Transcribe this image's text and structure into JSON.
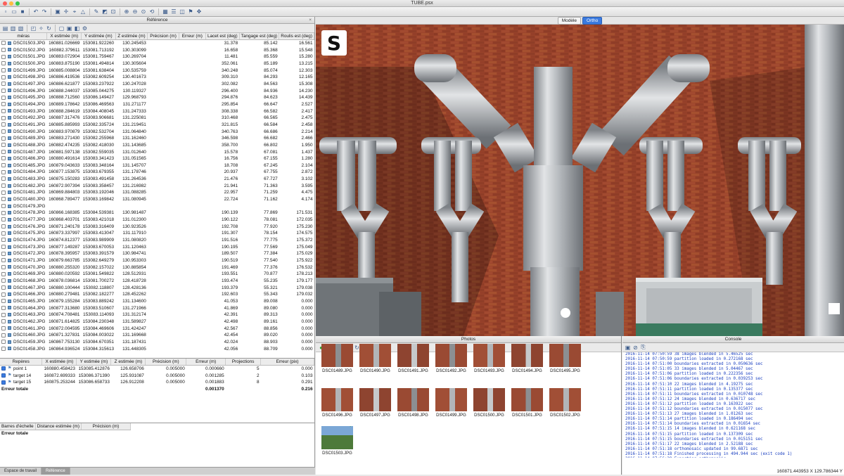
{
  "window": {
    "title": "TUBE.psx"
  },
  "reference_panel": {
    "title": "Référence",
    "columns": [
      "méras",
      "X estimée (m)",
      "Y estimée (m)",
      "Z estimée (m)",
      "Précision (m)",
      "Erreur (m)",
      "Lacet est (deg)",
      "Tangage est (deg)",
      "Roulis est (deg)"
    ],
    "cameras": [
      [
        "DSC01503.JPG",
        "160881.026669",
        "153081.922260",
        "130.245453",
        "",
        "",
        "31.378",
        "85.142",
        "16.561"
      ],
      [
        "DSC01502.JPG",
        "160882.379611",
        "153081.713192",
        "130.303099",
        "",
        "",
        "16.658",
        "85.368",
        "15.548"
      ],
      [
        "DSC01501.JPG",
        "160883.072904",
        "153081.759467",
        "130.269704",
        "",
        "",
        "11.481",
        "85.559",
        "15.280"
      ],
      [
        "DSC01500.JPG",
        "160883.875190",
        "153081.494814",
        "130.305604",
        "",
        "",
        "352.061",
        "85.189",
        "13.215"
      ],
      [
        "DSC01499.JPG",
        "160885.008804",
        "153081.638404",
        "130.535759",
        "",
        "",
        "340.248",
        "85.074",
        "12.303"
      ],
      [
        "DSC01498.JPG",
        "160886.419536",
        "153082.609254",
        "130.401673",
        "",
        "",
        "309.310",
        "84.293",
        "12.165"
      ],
      [
        "DSC01497.JPG",
        "160886.621877",
        "153083.237922",
        "130.247028",
        "",
        "",
        "302.082",
        "84.563",
        "15.308"
      ],
      [
        "DSC01496.JPG",
        "160888.244037",
        "153085.044275",
        "130.119327",
        "",
        "",
        "296.400",
        "84.936",
        "14.230"
      ],
      [
        "DSC01495.JPG",
        "160888.712560",
        "153086.149427",
        "129.968793",
        "",
        "",
        "294.876",
        "84.623",
        "14.439"
      ],
      [
        "DSC01494.JPG",
        "160889.178642",
        "153086.469563",
        "131.271177",
        "",
        "",
        "295.854",
        "66.647",
        "2.527"
      ],
      [
        "DSC01493.JPG",
        "160888.284619",
        "153084.408045",
        "131.247333",
        "",
        "",
        "308.338",
        "66.582",
        "2.417"
      ],
      [
        "DSC01492.JPG",
        "160887.317476",
        "153083.906681",
        "131.225081",
        "",
        "",
        "310.468",
        "66.565",
        "2.475"
      ],
      [
        "DSC01491.JPG",
        "160885.885993",
        "153082.335724",
        "131.219451",
        "",
        "",
        "321.815",
        "66.584",
        "2.458"
      ],
      [
        "DSC01490.JPG",
        "160883.970879",
        "153082.532704",
        "131.064840",
        "",
        "",
        "340.763",
        "66.686",
        "2.214"
      ],
      [
        "DSC01489.JPG",
        "160883.271430",
        "153082.255968",
        "131.162460",
        "",
        "",
        "346.598",
        "66.682",
        "2.466"
      ],
      [
        "DSC01488.JPG",
        "160882.474235",
        "153082.418030",
        "131.143685",
        "",
        "",
        "358.700",
        "66.802",
        "1.950"
      ],
      [
        "DSC01487.JPG",
        "160881.597138",
        "153082.559035",
        "131.012640",
        "",
        "",
        "15.578",
        "67.081",
        "1.437"
      ],
      [
        "DSC01486.JPG",
        "160880.491614",
        "153083.341423",
        "131.051565",
        "",
        "",
        "16.756",
        "67.155",
        "1.280"
      ],
      [
        "DSC01485.JPG",
        "160879.043633",
        "153083.348164",
        "131.145707",
        "",
        "",
        "18.708",
        "67.245",
        "2.104"
      ],
      [
        "DSC01484.JPG",
        "160877.153875",
        "153083.679355",
        "131.178746",
        "",
        "",
        "20.937",
        "67.755",
        "2.872"
      ],
      [
        "DSC01483.JPG",
        "160875.150283",
        "153083.491458",
        "131.264536",
        "",
        "",
        "21.476",
        "67.727",
        "3.102"
      ],
      [
        "DSC01482.JPG",
        "160872.907394",
        "153083.358457",
        "131.216982",
        "",
        "",
        "21.941",
        "71.363",
        "3.595"
      ],
      [
        "DSC01481.JPG",
        "160869.884803",
        "153083.192046",
        "131.088285",
        "",
        "",
        "22.957",
        "71.259",
        "4.475"
      ],
      [
        "DSC01480.JPG",
        "160868.789477",
        "153083.169842",
        "131.080945",
        "",
        "",
        "22.724",
        "71.162",
        "4.174"
      ],
      [
        "DSC01479.JPG",
        "",
        "",
        "",
        "",
        "",
        "",
        "",
        ""
      ],
      [
        "DSC01478.JPG",
        "160866.168385",
        "153084.539381",
        "130.981487",
        "",
        "",
        "190.139",
        "77.869",
        "171.531"
      ],
      [
        "DSC01477.JPG",
        "160868.403701",
        "153083.421018",
        "131.012300",
        "",
        "",
        "190.122",
        "78.081",
        "172.035"
      ],
      [
        "DSC01476.JPG",
        "160871.240178",
        "153083.316409",
        "130.923526",
        "",
        "",
        "192.708",
        "77.920",
        "175.230"
      ],
      [
        "DSC01475.JPG",
        "160873.337997",
        "153083.413047",
        "131.117910",
        "",
        "",
        "191.307",
        "78.154",
        "174.575"
      ],
      [
        "DSC01474.JPG",
        "160874.812377",
        "153083.989909",
        "131.080820",
        "",
        "",
        "191.516",
        "77.775",
        "175.372"
      ],
      [
        "DSC01473.JPG",
        "160877.149287",
        "153083.670053",
        "131.120463",
        "",
        "",
        "190.195",
        "77.569",
        "175.049"
      ],
      [
        "DSC01472.JPG",
        "160878.395957",
        "153083.391579",
        "130.984741",
        "",
        "",
        "189.507",
        "77.384",
        "175.029"
      ],
      [
        "DSC01471.JPG",
        "160879.663785",
        "153082.649279",
        "130.953303",
        "",
        "",
        "190.519",
        "77.540",
        "175.922"
      ],
      [
        "DSC01470.JPG",
        "160880.255320",
        "153082.157022",
        "130.885854",
        "",
        "",
        "191.469",
        "77.376",
        "176.532"
      ],
      [
        "DSC01469.JPG",
        "160880.020592",
        "153081.549822",
        "128.512931",
        "",
        "",
        "193.551",
        "70.877",
        "178.213"
      ],
      [
        "DSC01468.JPG",
        "160878.036814",
        "153081.700272",
        "128.418728",
        "",
        "",
        "193.474",
        "55.235",
        "179.177"
      ],
      [
        "DSC01467.JPG",
        "160880.100444",
        "153082.118807",
        "128.428136",
        "",
        "",
        "193.379",
        "55.321",
        "179.038"
      ],
      [
        "DSC01466.JPG",
        "160880.279481",
        "153082.182277",
        "128.452262",
        "",
        "",
        "192.603",
        "55.343",
        "179.032"
      ],
      [
        "DSC01465.JPG",
        "160879.155284",
        "153083.889242",
        "131.134600",
        "",
        "",
        "41.053",
        "89.008",
        "0.000"
      ],
      [
        "DSC01464.JPG",
        "160877.313680",
        "153083.510607",
        "131.271966",
        "",
        "",
        "41.869",
        "89.080",
        "0.000"
      ],
      [
        "DSC01463.JPG",
        "160874.708481",
        "153083.114093",
        "131.312174",
        "",
        "",
        "42.391",
        "89.313",
        "0.000"
      ],
      [
        "DSC01462.JPG",
        "160871.614825",
        "153084.230348",
        "131.589827",
        "",
        "",
        "42.498",
        "89.161",
        "0.000"
      ],
      [
        "DSC01461.JPG",
        "160872.004595",
        "153084.469606",
        "131.424247",
        "",
        "",
        "42.567",
        "88.856",
        "0.000"
      ],
      [
        "DSC01460.JPG",
        "160871.327831",
        "153084.003022",
        "131.169668",
        "",
        "",
        "42.454",
        "89.020",
        "0.000"
      ],
      [
        "DSC01459.JPG",
        "160867.753130",
        "153084.670351",
        "131.187431",
        "",
        "",
        "42.024",
        "88.903",
        "0.000"
      ],
      [
        "DSC01458.JPG",
        "160864.936524",
        "153084.315613",
        "131.448305",
        "",
        "",
        "42.056",
        "88.709",
        "0.000"
      ]
    ],
    "marker_columns": [
      "Repères",
      "X estimée (m)",
      "Y estimée (m)",
      "Z estimée (m)",
      "Précision (m)",
      "Erreur (m)",
      "Projections",
      "Erreur (pix)"
    ],
    "markers": [
      [
        "point 1",
        "160880.458423",
        "153085.412876",
        "126.658706",
        "0.005000",
        "0.000660",
        "5",
        "0.000"
      ],
      [
        "target 14",
        "160872.699333",
        "153086.371390",
        "125.931087",
        "0.005000",
        "0.001285",
        "2",
        "0.103"
      ],
      [
        "target 15",
        "160875.253244",
        "153086.658733",
        "126.912208",
        "0.005000",
        "0.001883",
        "8",
        "0.291"
      ]
    ],
    "marker_total": {
      "label": "Erreur totale",
      "error": "0.001370",
      "pix": "0.216"
    },
    "scale_columns": [
      "Barres d'échelle",
      "Distance estimée (m)",
      "Précision (m)"
    ],
    "scale_total": "Erreur totale",
    "tabs": [
      "Espace de travail",
      "Référence"
    ]
  },
  "view": {
    "tabs": [
      "Modèle",
      "Ortho"
    ],
    "active_tab": "Ortho",
    "logo_letter": "S"
  },
  "photos_panel": {
    "title": "Photos",
    "thumbnails": [
      {
        "name": "DSC01489.JPG",
        "checked": false
      },
      {
        "name": "DSC01490.JPG",
        "checked": false
      },
      {
        "name": "DSC01491.JPG",
        "checked": false
      },
      {
        "name": "DSC01492.JPG",
        "checked": false
      },
      {
        "name": "DSC01493.JPG",
        "checked": false
      },
      {
        "name": "DSC01494.JPG",
        "checked": false
      },
      {
        "name": "DSC01495.JPG",
        "checked": false
      },
      {
        "name": "DSC01496.JPG",
        "checked": true
      },
      {
        "name": "DSC01497.JPG",
        "checked": true
      },
      {
        "name": "DSC01498.JPG",
        "checked": true
      },
      {
        "name": "DSC01499.JPG",
        "checked": true
      },
      {
        "name": "DSC01500.JPG",
        "checked": true
      },
      {
        "name": "DSC01501.JPG",
        "checked": true
      },
      {
        "name": "DSC01502.JPG",
        "checked": true
      },
      {
        "name": "DSC01503.JPG",
        "checked": true
      }
    ]
  },
  "console_panel": {
    "title": "Console",
    "lines": [
      "2016-11-14 07:50:59 38 images blended in 5.46525 sec",
      "2016-11-14 07:50:59 partition loaded in 0.272168 sec",
      "2016-11-14 07:51:00 boundaries extracted in 0.050636 sec",
      "2016-11-14 07:51:05 33 images blended in 5.04467 sec",
      "2016-11-14 07:51:06 partition loaded in 0.222356 sec",
      "2016-11-14 07:51:06 boundaries extracted in 0.039253 sec",
      "2016-11-14 07:51:10 22 images blended in 4.19275 sec",
      "2016-11-14 07:51:11 partition loaded in 0.135377 sec",
      "2016-11-14 07:51:11 boundaries extracted in 0.010748 sec",
      "2016-11-14 07:51:12 24 images blended in 0.636717 sec",
      "2016-11-14 07:51:12 partition loaded in 0.163922 sec",
      "2016-11-14 07:51:12 boundaries extracted in 0.015077 sec",
      "2016-11-14 07:51:13 27 images blended in 1.01263 sec",
      "2016-11-14 07:51:14 partition loaded in 0.186494 sec",
      "2016-11-14 07:51:14 boundaries extracted in 0.01654 sec",
      "2016-11-14 07:51:15 14 images blended in 0.621168 sec",
      "2016-11-14 07:51:15 partition loaded in 0.137309 sec",
      "2016-11-14 07:51:15 boundaries extracted in 0.015151 sec",
      "2016-11-14 07:51:17 22 images blended in 2.52188 sec",
      "2016-11-14 07:51:18 orthomosaic updated in 99.6871 sec",
      "2016-11-14 07:51:18 Finished processing in 494.944 sec (exit code 1)",
      "2016-11-14 07:56:29 Exporting orthomosaic...",
      "2016-11-14 07:56:29 generating 1 x 1 tiles",
      "2016-11-14 07:57:17 Finished processing in 47.7269 sec (exit code 1)",
      ">>"
    ]
  },
  "status": {
    "coords": "160871.443953 X  129.786344 Y"
  },
  "colors": {
    "accent": "#3b7be0",
    "brick": "#8e3b25",
    "pipe": "#b9bcbf",
    "console_text": "#1a3fc0",
    "check": "#2fa52f"
  }
}
